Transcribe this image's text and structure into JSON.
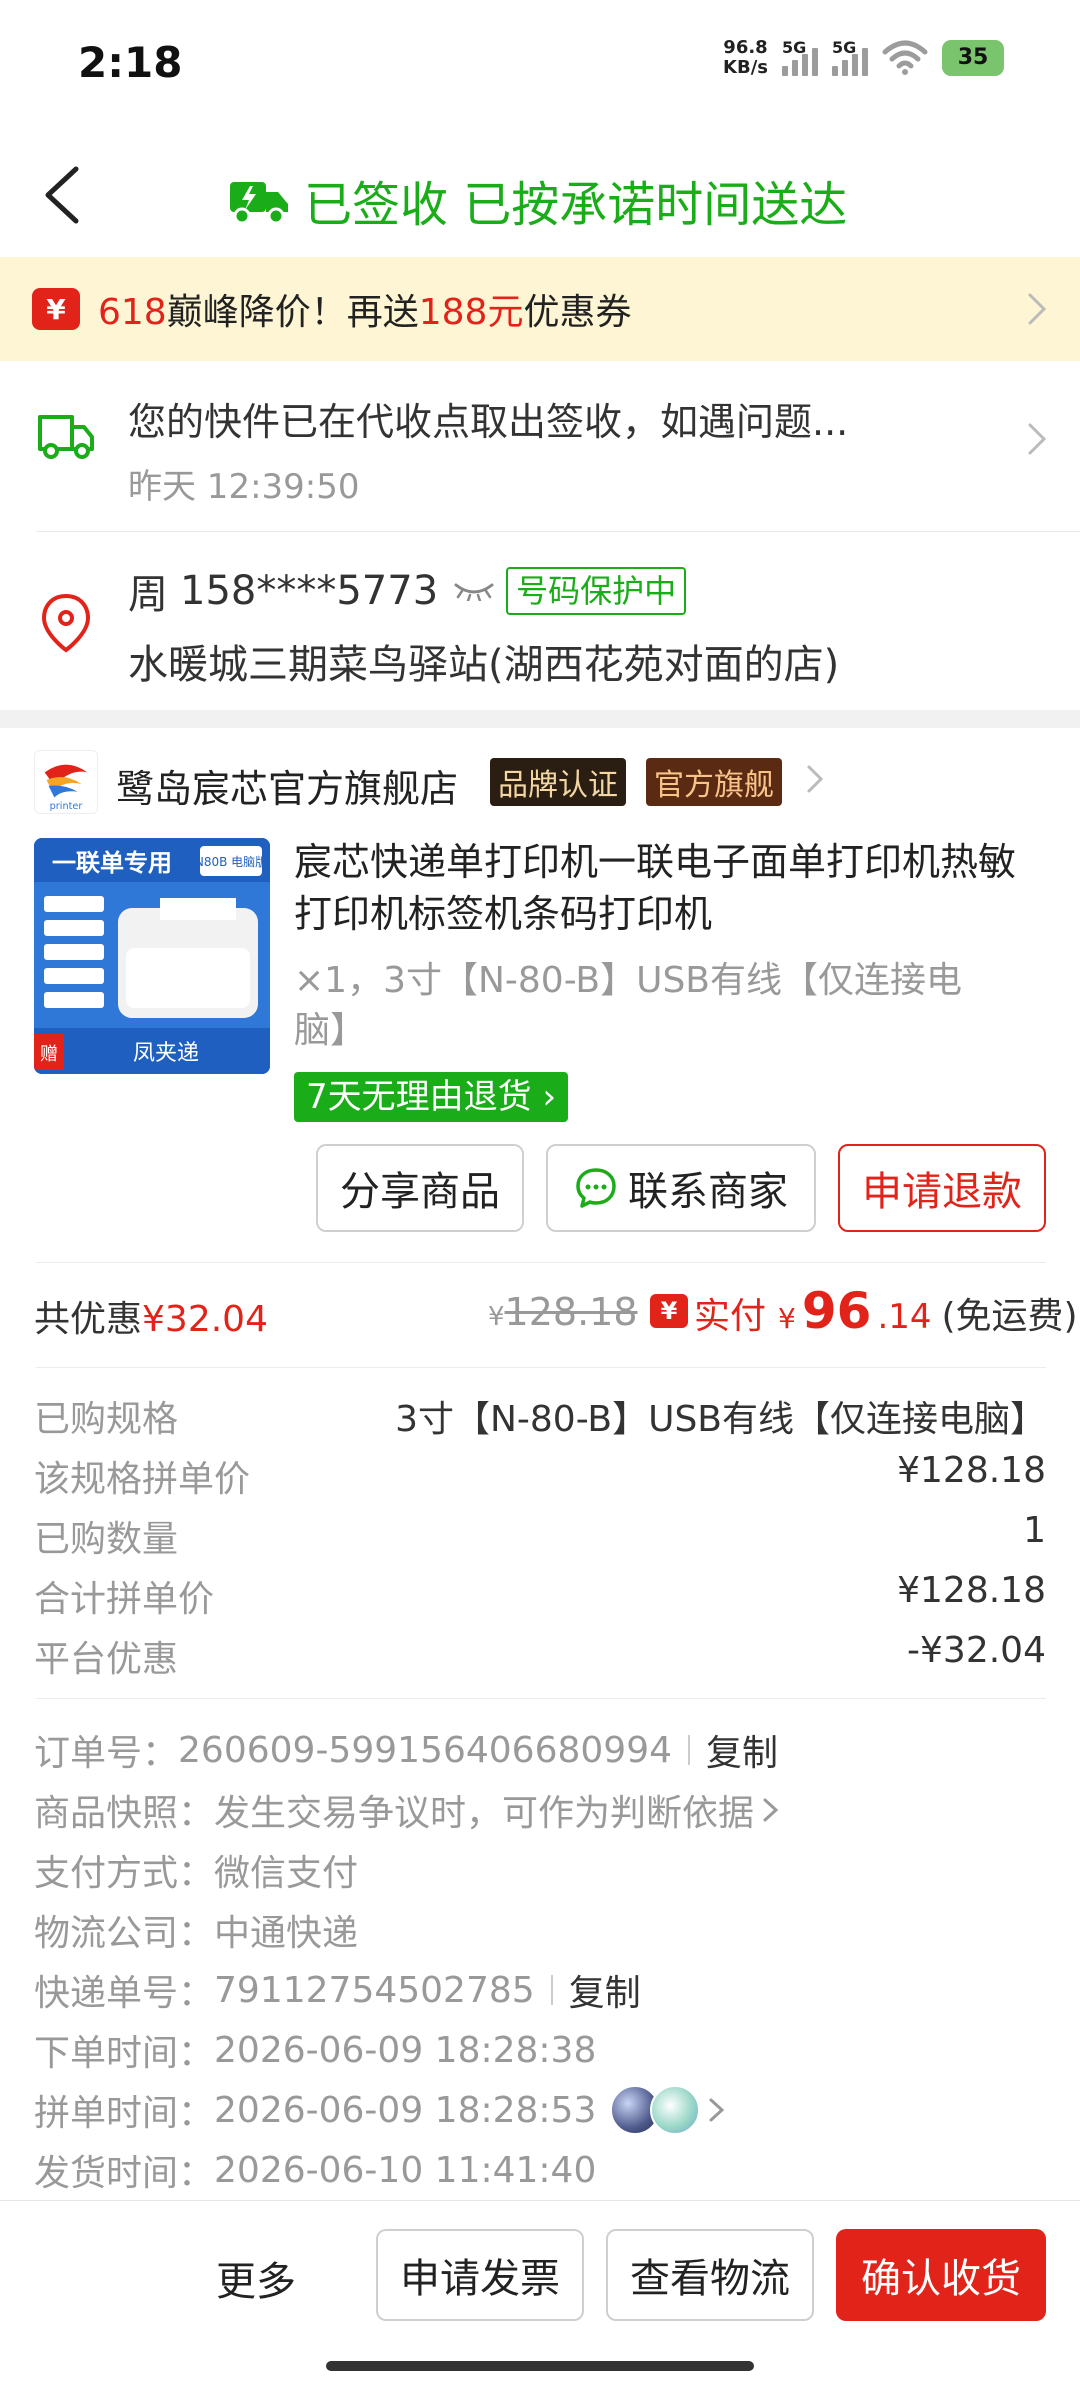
{
  "status_bar": {
    "time": "2:18",
    "net_speed_value": "96.8",
    "net_speed_unit": "KB/s",
    "sim1_label": "5G",
    "sim2_label": "5G",
    "battery": "35"
  },
  "header": {
    "title": "已签收 已按承诺时间送达",
    "color": "#1aad19"
  },
  "promo": {
    "icon_glyph": "¥",
    "num": "618",
    "text1": "巅峰降价！再送",
    "amount": "188元",
    "text2": "优惠券"
  },
  "logistics": {
    "message": "您的快件已在代收点取出签收，如遇问题...",
    "time": "昨天 12:39:50"
  },
  "address": {
    "name": "周",
    "phone": "158****5773",
    "protect_badge": "号码保护中",
    "line": "水暖城三期菜鸟驿站(湖西花苑对面的店)"
  },
  "store": {
    "name": "鹭岛宸芯官方旗舰店",
    "badge_brand": "品牌认证",
    "badge_official": "官方旗舰"
  },
  "product": {
    "image_banner": "一联单专用",
    "image_tag": "N80B 电脑版",
    "image_footer": "凤夹递",
    "image_gift": "赠",
    "title": "宸芯快递单打印机一联电子面单打印机热敏打印机标签机条码打印机",
    "spec": "×1，3寸【N-80-B】USB有线【仅连接电脑】",
    "return_badge": "7天无理由退货"
  },
  "actions": {
    "share": "分享商品",
    "contact": "联系商家",
    "refund": "申请退款"
  },
  "price": {
    "discount_label": "共优惠",
    "discount_value": "¥32.04",
    "orig_symbol": "¥",
    "orig_value": "128.18",
    "paid_icon": "¥",
    "paid_label": "实付",
    "paid_symbol": "¥",
    "paid_int": "96",
    "paid_dec": ".14",
    "shipping": "(免运费)"
  },
  "details": [
    {
      "label": "已购规格",
      "value": "3寸【N-80-B】USB有线【仅连接电脑】"
    },
    {
      "label": "该规格拼单价",
      "value": "¥128.18"
    },
    {
      "label": "已购数量",
      "value": "1"
    },
    {
      "label": "合计拼单价",
      "value": "¥128.18"
    },
    {
      "label": "平台优惠",
      "value": "-¥32.04"
    }
  ],
  "order_info": {
    "order_no_label": "订单号：",
    "order_no": "260609-599156406680994",
    "copy": "复制",
    "snapshot_label": "商品快照：",
    "snapshot_value": "发生交易争议时，可作为判断依据",
    "payment_label": "支付方式：",
    "payment_value": "微信支付",
    "carrier_label": "物流公司：",
    "carrier_value": "中通快递",
    "tracking_label": "快递单号：",
    "tracking_value": "79112754502785",
    "order_time_label": "下单时间：",
    "order_time_value": "2026-06-09 18:28:38",
    "group_time_label": "拼单时间：",
    "group_time_value": "2026-06-09 18:28:53",
    "ship_time_label": "发货时间：",
    "ship_time_value": "2026-06-10 11:41:40"
  },
  "bottom_bar": {
    "more": "更多",
    "invoice": "申请发票",
    "logistics": "查看物流",
    "confirm": "确认收货",
    "confirm_color": "#e2231a"
  }
}
